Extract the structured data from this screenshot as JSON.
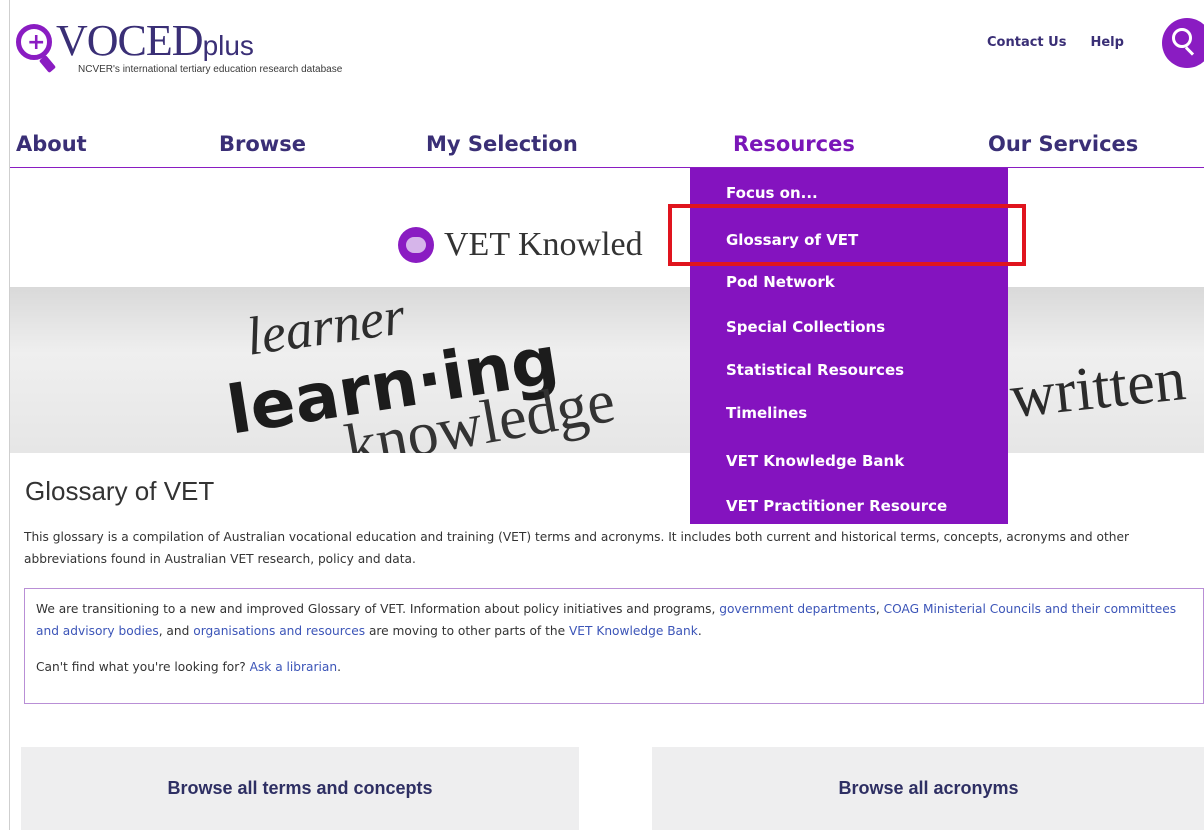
{
  "header": {
    "logo_main": "VOCED",
    "logo_suffix": "plus",
    "logo_tagline": "NCVER's international tertiary education research database",
    "top_links": [
      "Contact Us",
      "Help"
    ]
  },
  "nav": {
    "items": [
      "About",
      "Browse",
      "My Selection",
      "Resources",
      "Our Services"
    ],
    "active": "Resources"
  },
  "dropdown": {
    "items": [
      "Focus on...",
      "Glossary of VET",
      "Pod Network",
      "Special Collections",
      "Statistical Resources",
      "Timelines",
      "VET Knowledge Bank",
      "VET Practitioner Resource"
    ],
    "highlighted": "Glossary of VET"
  },
  "kb_title": "VET Knowled",
  "banner": {
    "words": [
      "learner",
      "learn·ing",
      "knowledge",
      "written"
    ]
  },
  "page": {
    "title": "Glossary of VET",
    "intro": "This glossary is a compilation of Australian vocational education and training (VET) terms and acronyms. It includes both current and historical terms, concepts, acronyms and other abbreviations found in Australian VET research, policy and data.",
    "notice": {
      "p1_a": "We are transitioning to a new and improved Glossary of VET. Information about policy initiatives and programs, ",
      "link_gov": "government departments",
      "p1_b": ", ",
      "link_coag": "COAG Ministerial Councils and their committees and advisory bodies",
      "p1_c": ", and ",
      "link_orgs": "organisations and resources",
      "p1_d": " are moving to other parts of the ",
      "link_kb": "VET Knowledge Bank",
      "p1_e": ".",
      "p2_a": "Can't find what you're looking for? ",
      "link_librarian": "Ask a librarian",
      "p2_b": "."
    },
    "cards": [
      "Browse all terms and concepts",
      "Browse all acronyms"
    ]
  },
  "colors": {
    "brand_purple": "#8a1cc2",
    "navy": "#3a2f76",
    "dropdown_bg": "#8413bf",
    "highlight": "#e0141e",
    "link": "#3c55b8"
  }
}
